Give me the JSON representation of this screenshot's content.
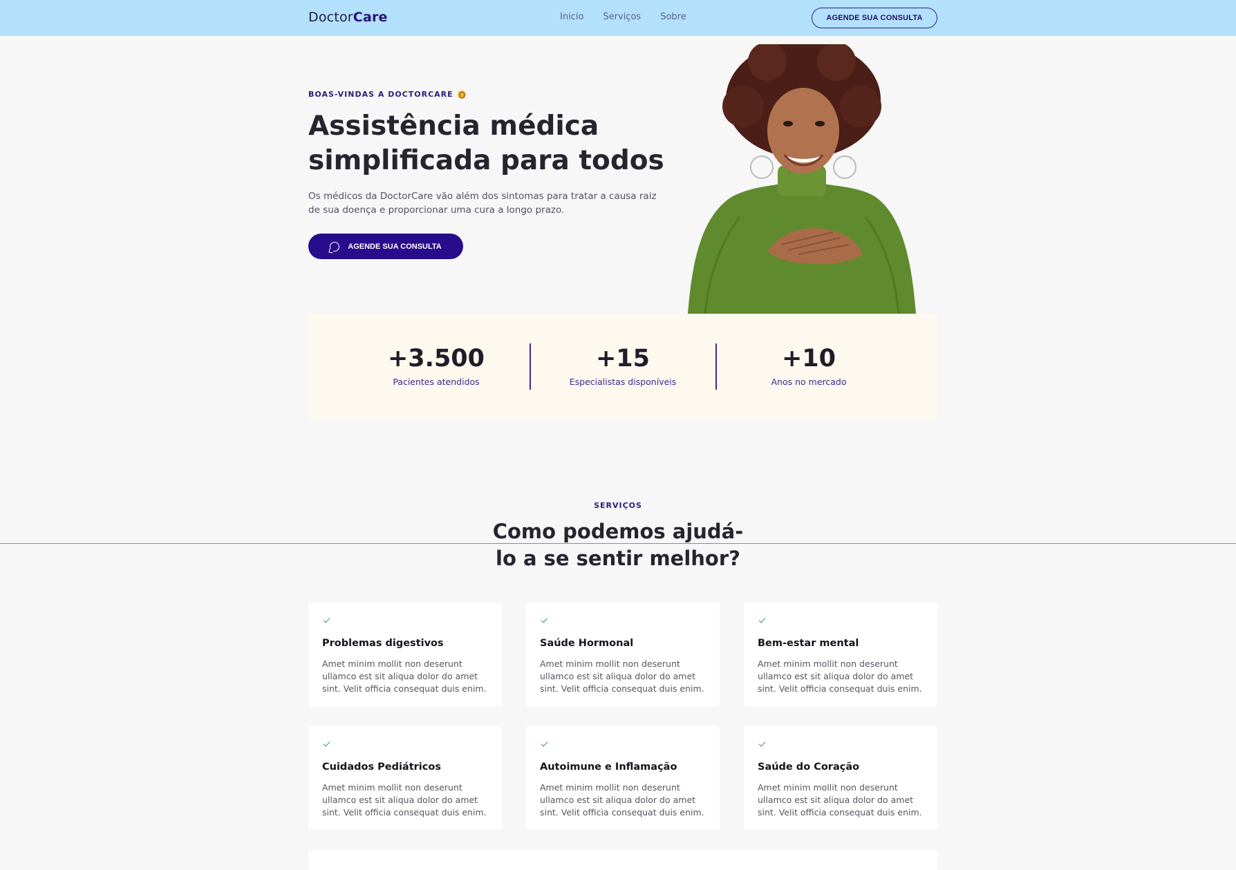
{
  "header": {
    "logo_first": "Doctor",
    "logo_second": "Care",
    "nav": [
      "Inicio",
      "Serviços",
      "Sobre"
    ],
    "cta": "AGENDE SUA CONSULTA"
  },
  "hero": {
    "eyebrow": "BOAS-VINDAS A DOCTORCARE",
    "title_line1": "Assistência médica",
    "title_line2": "simplificada para todos",
    "text": "Os médicos da DoctorCare vão além dos sintomas para tratar a causa raiz de sua doença e proporcionar uma cura a longo prazo.",
    "cta": "AGENDE SUA CONSULTA"
  },
  "stats": [
    {
      "value": "+3.500",
      "label": "Pacientes atendidos"
    },
    {
      "value": "+15",
      "label": "Especialistas disponíveis"
    },
    {
      "value": "+10",
      "label": "Anos no mercado"
    }
  ],
  "services": {
    "eyebrow": "SERVIÇOS",
    "title_line1": "Como podemos ajudá-",
    "title_line2": "lo a se sentir melhor?",
    "cards": [
      {
        "title": "Problemas digestivos",
        "text": "Amet minim mollit non deserunt ullamco est sit aliqua dolor do amet sint. Velit officia consequat duis enim."
      },
      {
        "title": "Saúde Hormonal",
        "text": "Amet minim mollit non deserunt ullamco est sit aliqua dolor do amet sint. Velit officia consequat duis enim."
      },
      {
        "title": "Bem-estar mental",
        "text": "Amet minim mollit non deserunt ullamco est sit aliqua dolor do amet sint. Velit officia consequat duis enim."
      },
      {
        "title": "Cuidados Pediátricos",
        "text": "Amet minim mollit non deserunt ullamco est sit aliqua dolor do amet sint. Velit officia consequat duis enim."
      },
      {
        "title": "Autoimune e Inflamação",
        "text": "Amet minim mollit non deserunt ullamco est sit aliqua dolor do amet sint. Velit officia consequat duis enim."
      },
      {
        "title": "Saúde do Coração",
        "text": "Amet minim mollit non deserunt ullamco est sit aliqua dolor do amet sint. Velit officia consequat duis enim."
      }
    ]
  },
  "colors": {
    "header_bg": "#b3e1fc",
    "brand": "#270c8b",
    "stats_bg": "#fdf9ee",
    "check": "#2a9d5c"
  }
}
